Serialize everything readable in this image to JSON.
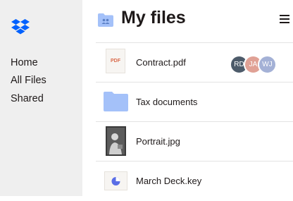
{
  "sidebar": {
    "logo_icon": "dropbox-logo-icon",
    "items": [
      {
        "label": "Home"
      },
      {
        "label": "All Files"
      },
      {
        "label": "Shared"
      }
    ]
  },
  "header": {
    "title": "My files",
    "folder_icon": "shared-folder-icon",
    "menu_icon": "menu-icon"
  },
  "files": [
    {
      "name": "Contract.pdf",
      "type": "pdf",
      "thumb_label": "PDF",
      "shared_with": [
        {
          "initials": "RD",
          "color": "#4d5b6a"
        },
        {
          "initials": "JA",
          "color": "#e0a195"
        },
        {
          "initials": "WJ",
          "color": "#a4b1d6"
        }
      ]
    },
    {
      "name": "Tax documents",
      "type": "folder"
    },
    {
      "name": "Portrait.jpg",
      "type": "image"
    },
    {
      "name": "March Deck.key",
      "type": "keynote"
    }
  ],
  "colors": {
    "brand": "#0061fe",
    "folder": "#a4c1f9",
    "sidebar_bg": "#efefef",
    "text": "#1e1919",
    "keynote_accent": "#5a6ee6"
  }
}
